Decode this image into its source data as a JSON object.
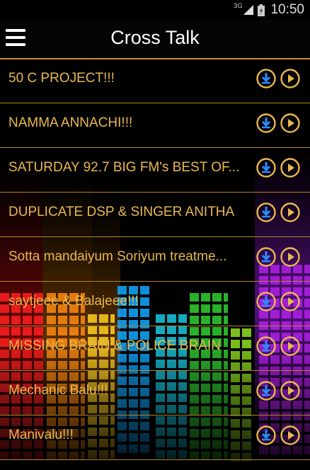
{
  "status_bar": {
    "network": "3G",
    "time": "10:50"
  },
  "action_bar": {
    "title": "Cross Talk"
  },
  "colors": {
    "accent": "#e9b84e",
    "divider": "#b38426",
    "background": "#000000"
  },
  "items": [
    {
      "label": "50 C PROJECT!!!"
    },
    {
      "label": "NAMMA ANNACHI!!!"
    },
    {
      "label": "SATURDAY 92.7 BIG FM's BEST OF..."
    },
    {
      "label": "DUPLICATE DSP & SINGER ANITHA"
    },
    {
      "label": "Sotta mandaiyum Soriyum treatme..."
    },
    {
      "label": "saytjeee & Balajeee!!!"
    },
    {
      "label": "MISSING BRAIN & POLICE BRAIN"
    },
    {
      "label": "Mechanic Balu!!!"
    },
    {
      "label": "Manivalu!!!"
    }
  ]
}
